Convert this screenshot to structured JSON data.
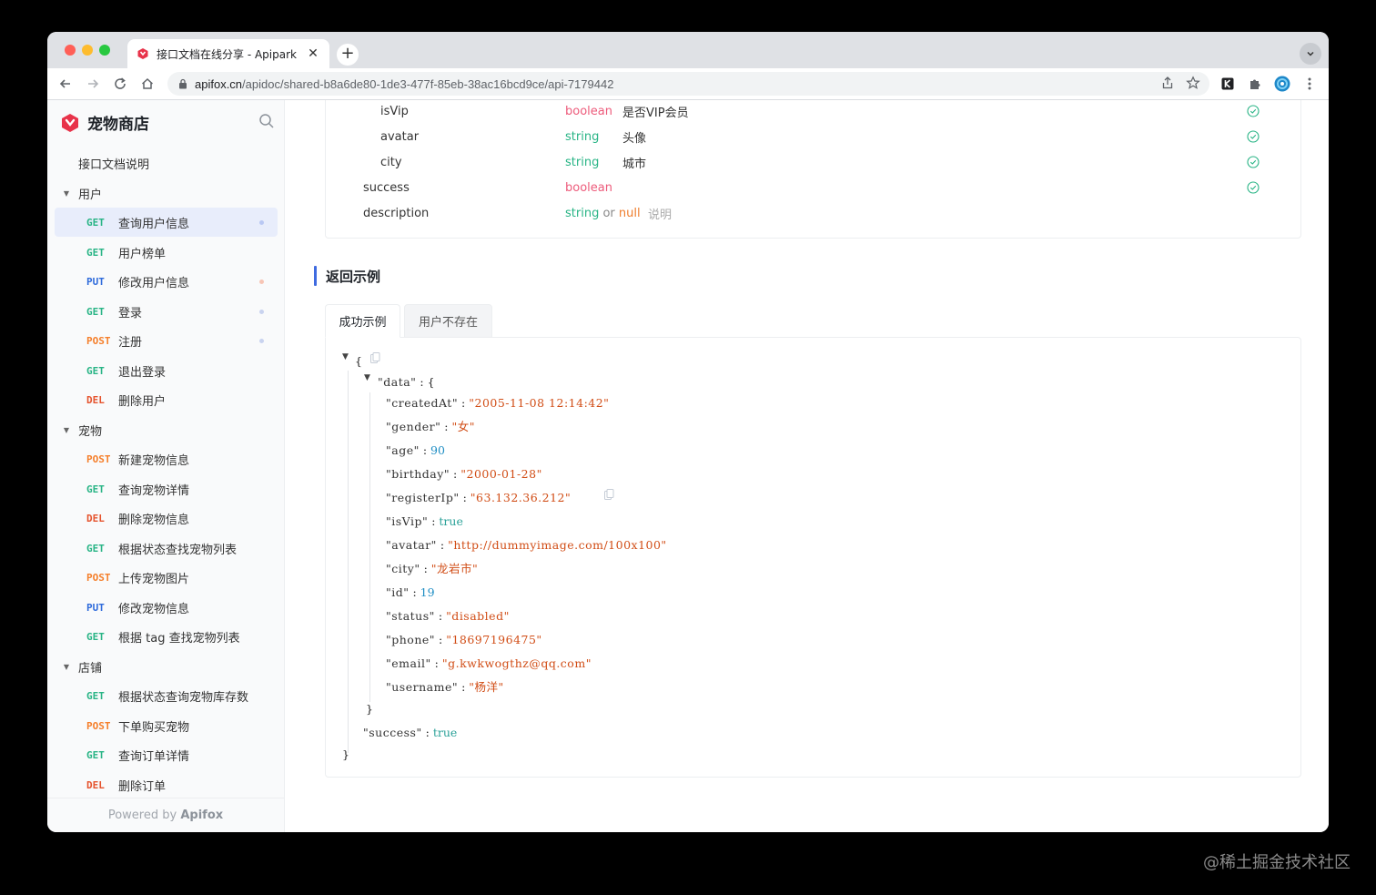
{
  "browser": {
    "tab_title": "接口文档在线分享 - Apipark",
    "url_domain": "apifox.cn",
    "url_path": "/apidoc/shared-b8a6de80-1de3-477f-85eb-38ac16bcd9ce/api-7179442"
  },
  "sidebar": {
    "project_name": "宠物商店",
    "doc_link": "接口文档说明",
    "groups": [
      {
        "label": "用户"
      },
      {
        "label": "宠物"
      },
      {
        "label": "店铺"
      }
    ],
    "items": [
      {
        "method": "GET",
        "label": "查询用户信息",
        "dot": "#b9c8f3"
      },
      {
        "method": "GET",
        "label": "用户榜单",
        "dot": ""
      },
      {
        "method": "PUT",
        "label": "修改用户信息",
        "dot": "#f7c5b5"
      },
      {
        "method": "GET",
        "label": "登录",
        "dot": "#c9d3ef"
      },
      {
        "method": "POST",
        "label": "注册",
        "dot": "#c9d3ef"
      },
      {
        "method": "GET",
        "label": "退出登录",
        "dot": ""
      },
      {
        "method": "DEL",
        "label": "删除用户",
        "dot": ""
      },
      {
        "method": "POST",
        "label": "新建宠物信息",
        "dot": ""
      },
      {
        "method": "GET",
        "label": "查询宠物详情",
        "dot": ""
      },
      {
        "method": "DEL",
        "label": "删除宠物信息",
        "dot": ""
      },
      {
        "method": "GET",
        "label": "根据状态查找宠物列表",
        "dot": ""
      },
      {
        "method": "POST",
        "label": "上传宠物图片",
        "dot": ""
      },
      {
        "method": "PUT",
        "label": "修改宠物信息",
        "dot": ""
      },
      {
        "method": "GET",
        "label": "根据 tag 查找宠物列表",
        "dot": ""
      },
      {
        "method": "GET",
        "label": "根据状态查询宠物库存数",
        "dot": ""
      },
      {
        "method": "POST",
        "label": "下单购买宠物",
        "dot": ""
      },
      {
        "method": "GET",
        "label": "查询订单详情",
        "dot": ""
      },
      {
        "method": "DEL",
        "label": "删除订单",
        "dot": ""
      }
    ],
    "powered_prefix": "Powered by",
    "powered_brand": "Apifox"
  },
  "schema_rows": [
    {
      "name": "isVip",
      "type": "boolean",
      "desc": "是否VIP会员",
      "required": true
    },
    {
      "name": "avatar",
      "type": "string",
      "desc": "头像",
      "required": true
    },
    {
      "name": "city",
      "type": "string",
      "desc": "城市",
      "required": true
    },
    {
      "name": "success",
      "type": "boolean",
      "desc": "",
      "required": true
    },
    {
      "name": "description",
      "type": "string",
      "type_or": "or",
      "type_alt": "null",
      "desc": "说明",
      "required": false
    }
  ],
  "response_section": {
    "title": "返回示例",
    "tabs": [
      "成功示例",
      "用户不存在"
    ],
    "active_tab": "成功示例"
  },
  "json_example": {
    "data_key": "\"data\"",
    "success_key": "\"success\"",
    "success_value": "true",
    "fields": [
      {
        "key": "\"createdAt\"",
        "value": "\"2005-11-08 12:14:42\"",
        "kind": "string"
      },
      {
        "key": "\"gender\"",
        "value": "\"女\"",
        "kind": "string"
      },
      {
        "key": "\"age\"",
        "value": "90",
        "kind": "number"
      },
      {
        "key": "\"birthday\"",
        "value": "\"2000-01-28\"",
        "kind": "string"
      },
      {
        "key": "\"registerIp\"",
        "value": "\"63.132.36.212\"",
        "kind": "string"
      },
      {
        "key": "\"isVip\"",
        "value": "true",
        "kind": "bool"
      },
      {
        "key": "\"avatar\"",
        "value": "\"http://dummyimage.com/100x100\"",
        "kind": "string"
      },
      {
        "key": "\"city\"",
        "value": "\"龙岩市\"",
        "kind": "string"
      },
      {
        "key": "\"id\"",
        "value": "19",
        "kind": "number"
      },
      {
        "key": "\"status\"",
        "value": "\"disabled\"",
        "kind": "string"
      },
      {
        "key": "\"phone\"",
        "value": "\"18697196475\"",
        "kind": "string"
      },
      {
        "key": "\"email\"",
        "value": "\"g.kwkwogthz@qq.com\"",
        "kind": "string"
      },
      {
        "key": "\"username\"",
        "value": "\"杨洋\"",
        "kind": "string"
      }
    ]
  },
  "watermark": "@稀土掘金技术社区",
  "colors": {
    "accent": "#3f6be0",
    "get": "#28b485",
    "put": "#2f6bdb",
    "post": "#f57f2b",
    "del": "#e5532d"
  }
}
